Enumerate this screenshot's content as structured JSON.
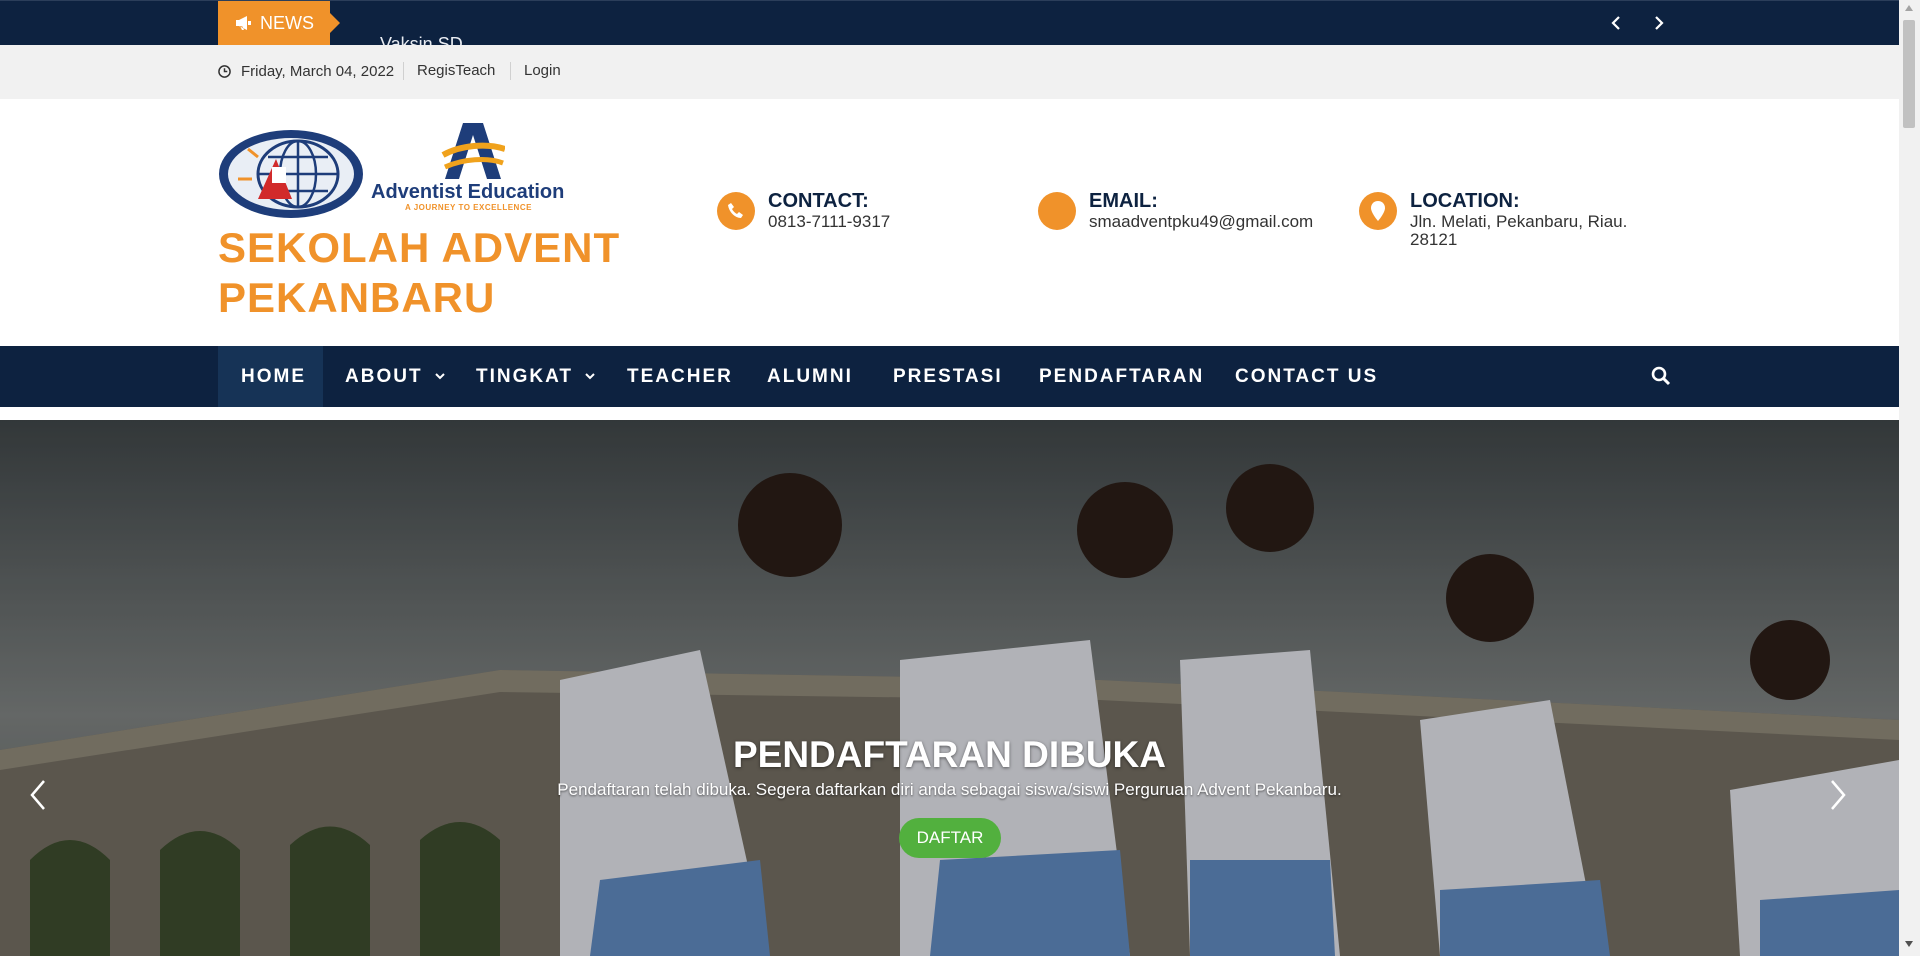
{
  "ticker": {
    "badge": "NEWS",
    "headline": "Vaksin SD",
    "prev_icon": "chevron-left-icon",
    "next_icon": "chevron-right-icon"
  },
  "topbar": {
    "date": "Friday, March 04, 2022",
    "links": [
      "RegisTeach",
      "Login"
    ]
  },
  "header": {
    "logo_text": "Adventist Education",
    "logo_tagline": "A JOURNEY TO EXCELLENCE",
    "title_line1": "SEKOLAH ADVENT",
    "title_line2": "PEKANBARU",
    "contact": {
      "label": "CONTACT:",
      "value": "0813-7111-9317",
      "icon": "phone-icon"
    },
    "email": {
      "label": "EMAIL:",
      "value": "smaadventpku49@gmail.com",
      "icon": "envelope-icon"
    },
    "location": {
      "label": "LOCATION:",
      "value": "Jln. Melati, Pekanbaru, Riau. 28121",
      "icon": "map-pin-icon"
    }
  },
  "nav": {
    "items": [
      {
        "label": "HOME"
      },
      {
        "label": "ABOUT"
      },
      {
        "label": "TINGKAT"
      },
      {
        "label": "TEACHER"
      },
      {
        "label": "ALUMNI"
      },
      {
        "label": "PRESTASI"
      },
      {
        "label": "PENDAFTARAN"
      },
      {
        "label": "CONTACT US"
      }
    ],
    "active": "HOME"
  },
  "hero": {
    "title": "PENDAFTARAN DIBUKA",
    "text": "Pendaftaran telah dibuka. Segera daftarkan diri anda sebagai siswa/siswi Perguruan Advent Pekanbaru.",
    "button": "DAFTAR"
  },
  "colors": {
    "navy": "#0d2240",
    "orange": "#f0922a",
    "green": "#52b03e"
  }
}
